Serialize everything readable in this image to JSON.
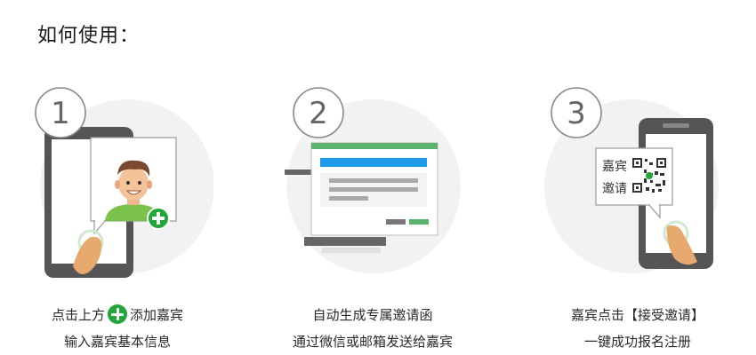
{
  "title": "如何使用：",
  "steps": [
    {
      "number": "1",
      "caption_line1_pre": "点击上方",
      "caption_line1_post": "添加嘉宾",
      "caption_line2": "输入嘉宾基本信息"
    },
    {
      "number": "2",
      "caption_line1": "自动生成专属邀请函",
      "caption_line2": "通过微信或邮箱发送给嘉宾"
    },
    {
      "number": "3",
      "card_line1": "嘉宾",
      "card_line2": "邀请",
      "caption_line1": "嘉宾点击【接受邀请】",
      "caption_line2": "一键成功报名注册"
    }
  ],
  "colors": {
    "accent_green": "#21a63a",
    "circle_bg": "#f2f2f2",
    "phone_gray": "#555555",
    "blue_bar": "#1e9be8",
    "window_header": "#5cb36b"
  }
}
